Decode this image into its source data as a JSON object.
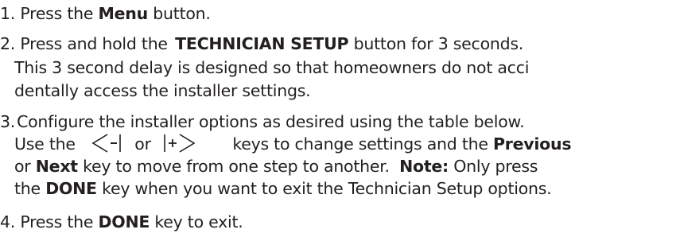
{
  "steps": [
    {
      "num": "1.",
      "press": "Press the",
      "menu": "Menu",
      "button": "button."
    },
    {
      "num": "2.",
      "press_hold": "Press and hold the",
      "tech_setup": "TECHNICIAN SETUP",
      "for_3s": "button for 3 seconds.",
      "line2": "This 3 second delay is designed so that homeowners do not acci",
      "line3": "dentally access the  installer settings."
    },
    {
      "num": "3.",
      "line1": "Configure the installer options as desired using the table below.",
      "use_the": "Use the",
      "or": "or",
      "keys_change": "keys to change settings and the",
      "previous": "Previous",
      "or_word": "or",
      "next": "Next",
      "key_move": "key to move from one step to another.",
      "note": "Note:",
      "only_press": "Only press",
      "the": "the",
      "done": "DONE",
      "key_exit": "key when you want to exit the Technician Setup options."
    },
    {
      "num": "4.",
      "press_the": "Press the",
      "done": "DONE",
      "key_to_exit": "key to exit."
    }
  ],
  "icons": {
    "minus_key": "minus-arrow-key-icon",
    "plus_key": "plus-arrow-key-icon"
  }
}
